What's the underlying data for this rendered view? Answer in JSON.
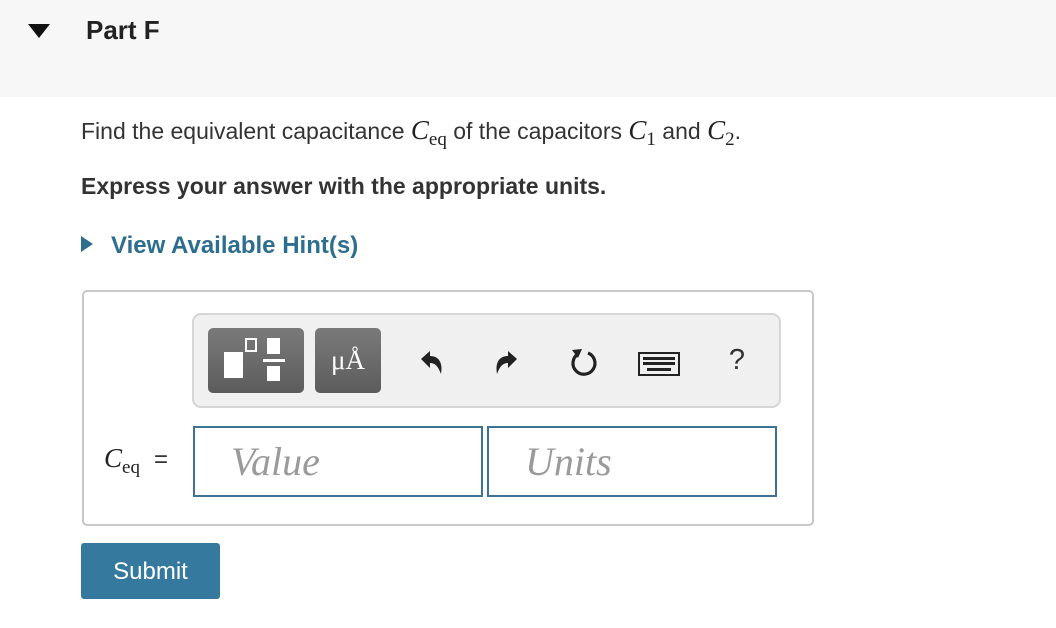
{
  "header": {
    "title": "Part F"
  },
  "question": {
    "prefix": "Find the equivalent capacitance ",
    "ceq_symbol": "C",
    "ceq_sub": "eq",
    "mid": " of the capacitors ",
    "c1_symbol": "C",
    "c1_sub": "1",
    "and": " and ",
    "c2_symbol": "C",
    "c2_sub": "2",
    "end": "."
  },
  "instruction": "Express your answer with the appropriate units.",
  "hint": {
    "label": "View Available Hint(s)"
  },
  "toolbar": {
    "templates_icon": "fraction-templates-icon",
    "units_label": "μÅ",
    "undo_icon": "undo-icon",
    "redo_icon": "redo-icon",
    "reset_icon": "reset-icon",
    "keyboard_icon": "keyboard-icon",
    "help_label": "?"
  },
  "answer": {
    "lhs_symbol": "C",
    "lhs_sub": "eq",
    "equals": "=",
    "value_placeholder": "Value",
    "units_placeholder": "Units"
  },
  "submit_label": "Submit",
  "colors": {
    "accent": "#357a9e",
    "link": "#2d6e8e",
    "header_bg": "#f7f7f7"
  }
}
